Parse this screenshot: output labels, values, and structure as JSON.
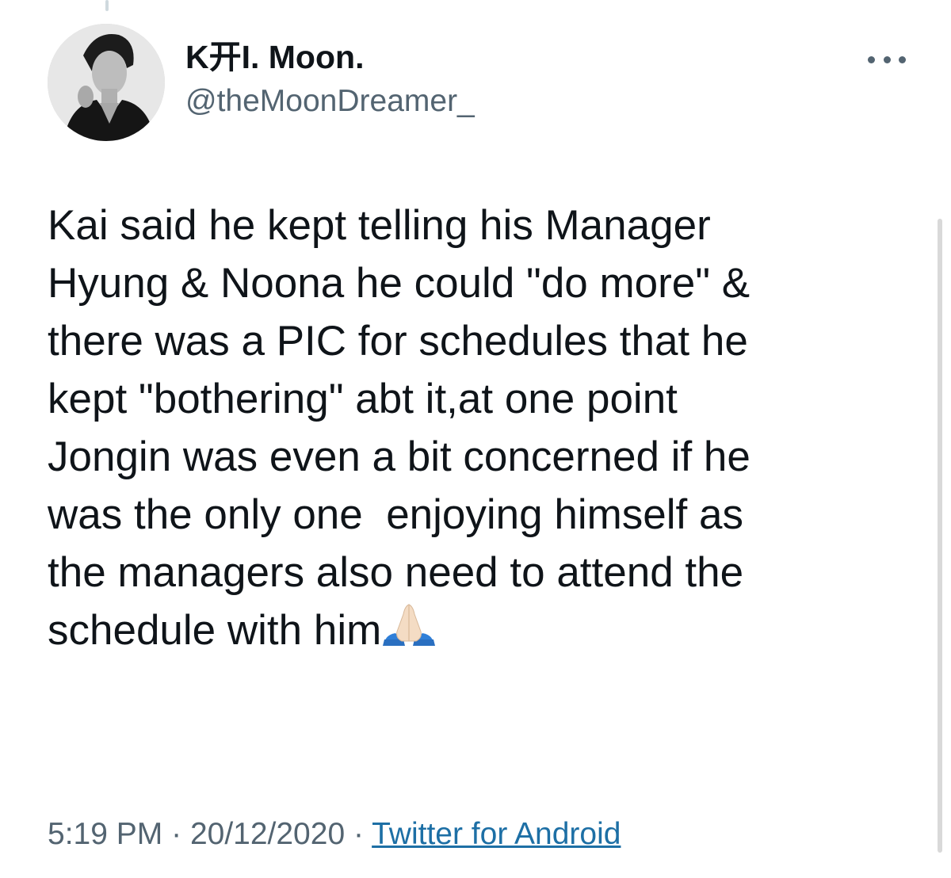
{
  "tweet": {
    "author": {
      "display_name": "K开I. Moon.",
      "handle": "@theMoonDreamer_"
    },
    "more_icon": "more-horizontal-icon",
    "text_lines": [
      "Kai said he kept telling his Manager",
      "Hyung & Noona he could \"do more\" &",
      "there was a PIC for schedules that he",
      "kept \"bothering\" abt it,at one point",
      "Jongin was even a bit concerned if he",
      "was the only one  enjoying himself as",
      "the managers also need to attend the",
      "schedule with him"
    ],
    "emoji": "folded-hands-icon",
    "time": "5:19 PM",
    "separator": "·",
    "date": "20/12/2020",
    "source": "Twitter for Android"
  },
  "colors": {
    "primary_text": "#0f1419",
    "secondary_text": "#536471",
    "link": "#1d6fa5"
  }
}
